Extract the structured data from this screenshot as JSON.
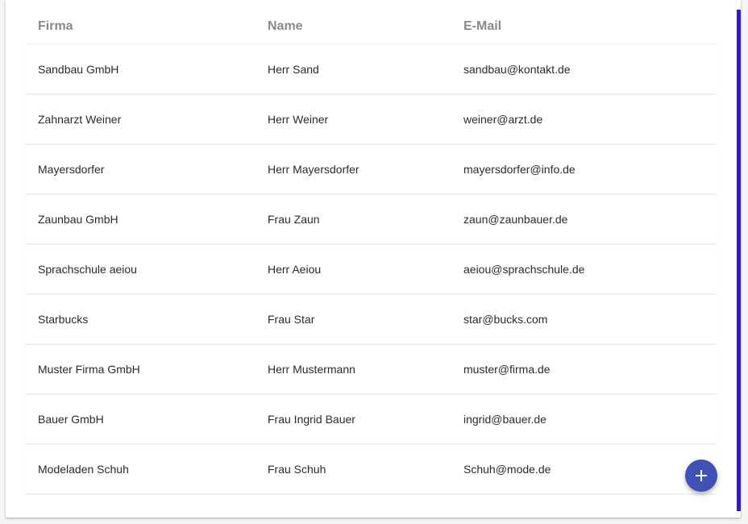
{
  "table": {
    "headers": [
      "Firma",
      "Name",
      "E-Mail"
    ],
    "rows": [
      [
        "Sandbau GmbH",
        "Herr Sand",
        "sandbau@kontakt.de"
      ],
      [
        "Zahnarzt Weiner",
        "Herr Weiner",
        "weiner@arzt.de"
      ],
      [
        "Mayersdorfer",
        "Herr Mayersdorfer",
        "mayersdorfer@info.de"
      ],
      [
        "Zaunbau GmbH",
        "Frau Zaun",
        "zaun@zaunbauer.de"
      ],
      [
        "Sprachschule aeiou",
        "Herr Aeiou",
        "aeiou@sprachschule.de"
      ],
      [
        "Starbucks",
        "Frau Star",
        "star@bucks.com"
      ],
      [
        "Muster Firma GmbH",
        "Herr Mustermann",
        "muster@firma.de"
      ],
      [
        "Bauer GmbH",
        "Frau Ingrid Bauer",
        "ingrid@bauer.de"
      ],
      [
        "Modeladen Schuh",
        "Frau Schuh",
        "Schuh@mode.de"
      ]
    ]
  },
  "fab": {
    "icon": "plus-icon"
  },
  "colors": {
    "accent_bar": "#3417c8",
    "fab": "#3f51b5",
    "header_text": "#8a8a8a"
  }
}
